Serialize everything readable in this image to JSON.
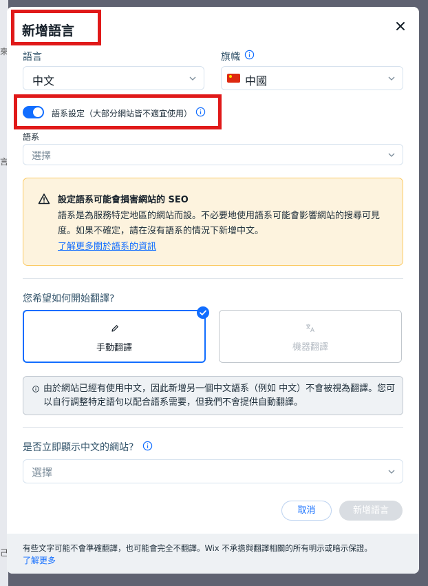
{
  "background": {
    "hint_1": "來",
    "hint_2": "言",
    "hint_3": "己"
  },
  "dialog": {
    "title": "新增語言",
    "close_icon": "close-icon"
  },
  "language_field": {
    "label": "語言",
    "value": "中文"
  },
  "flag_field": {
    "label": "旗幟",
    "value": "中國",
    "flag_icon": "china-flag-icon"
  },
  "dialect_toggle": {
    "label": "語系設定（大部分網站皆不適宜使用）",
    "on": true
  },
  "dialect_field": {
    "label": "語系",
    "placeholder": "選擇"
  },
  "warning": {
    "title": "設定語系可能會損害網站的 SEO",
    "body": "語系是為服務特定地區的網站而設。不必要地使用語系可能會影響網站的搜尋可見度。如果不確定，請在沒有語系的情況下新增中文。",
    "link": "了解更多關於語系的資訊"
  },
  "translation": {
    "question": "您希望如何開始翻譯?",
    "manual_label": "手動翻譯",
    "machine_label": "機器翻譯"
  },
  "note": {
    "text": "由於網站已經有使用中文，因此新增另一個中文語系（例如 中文）不會被視為翻譯。您可以自行調整特定語句以配合語系需要，但我們不會提供自動翻譯。"
  },
  "display_field": {
    "label": "是否立即顯示中文的網站?",
    "placeholder": "選擇"
  },
  "buttons": {
    "cancel": "取消",
    "add": "新增語言"
  },
  "footer": {
    "text": "有些文字可能不會準確翻譯，也可能會完全不翻譯。Wix 不承擔與翻譯相關的所有明示或暗示保證。",
    "link": "了解更多"
  },
  "colors": {
    "accent": "#116dff",
    "warning_bg": "#fdf3de",
    "warning_border": "#fbca63",
    "highlight": "#e01919"
  }
}
